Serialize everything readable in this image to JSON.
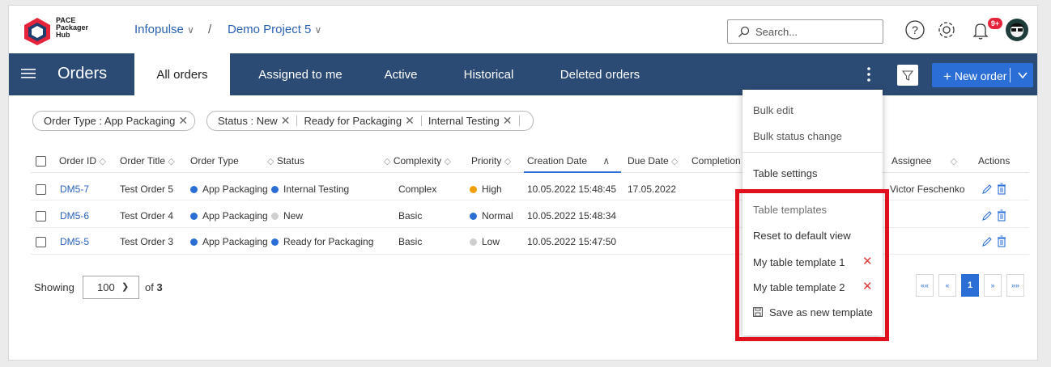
{
  "brand": {
    "line1": "PACE",
    "line2": "Packager",
    "line3": "Hub"
  },
  "breadcrumb": {
    "org": "Infopulse",
    "separator": "/",
    "project": "Demo Project 5"
  },
  "search": {
    "placeholder": "Search..."
  },
  "notifications": {
    "badge": "9+"
  },
  "nav": {
    "title": "Orders",
    "tabs": [
      "All orders",
      "Assigned to me",
      "Active",
      "Historical",
      "Deleted orders"
    ],
    "active_tab": "All orders",
    "new_order_label": "New order"
  },
  "filters": [
    {
      "label": "Order Type : App Packaging"
    },
    {
      "label": "Status : New",
      "values": [
        "Ready for Packaging",
        "Internal Testing"
      ]
    }
  ],
  "table": {
    "columns": [
      "Order ID",
      "Order Title",
      "Order Type",
      "Status",
      "Complexity",
      "Priority",
      "Creation Date",
      "Due Date",
      "Completion",
      "Assignee",
      "Actions"
    ],
    "rows": [
      {
        "id": "DM5-7",
        "title": "Test Order 5",
        "type": "App Packaging",
        "status": "Internal Testing",
        "complexity": "Complex",
        "priority": "High",
        "created": "10.05.2022 15:48:45",
        "due": "17.05.2022",
        "assignee": "Victor Feschenko"
      },
      {
        "id": "DM5-6",
        "title": "Test Order 4",
        "type": "App Packaging",
        "status": "New",
        "complexity": "Basic",
        "priority": "Normal",
        "created": "10.05.2022 15:48:34",
        "due": "",
        "assignee": ""
      },
      {
        "id": "DM5-5",
        "title": "Test Order 3",
        "type": "App Packaging",
        "status": "Ready for Packaging",
        "complexity": "Basic",
        "priority": "Low",
        "created": "10.05.2022 15:47:50",
        "due": "",
        "assignee": ""
      }
    ]
  },
  "footer": {
    "showing_label": "Showing",
    "page_size": "100",
    "of_label": "of",
    "total": "3",
    "current_page": "1",
    "pager_first": "««",
    "pager_prev": "«",
    "pager_next": "»",
    "pager_last": "»»"
  },
  "menu": {
    "bulk_edit": "Bulk edit",
    "bulk_status": "Bulk status change",
    "table_settings": "Table settings",
    "templates_header": "Table templates",
    "reset_default": "Reset to default view",
    "template_1": "My table template 1",
    "template_2": "My table template 2",
    "save_new": "Save as new template"
  },
  "colors": {
    "navbar": "#2b4a74",
    "accent": "#2b6fd6",
    "highlight": "#e0101c",
    "high": "#f0a000",
    "normal": "#2b6fd6",
    "low": "#cfcfcf",
    "new": "#cfcfcf"
  }
}
